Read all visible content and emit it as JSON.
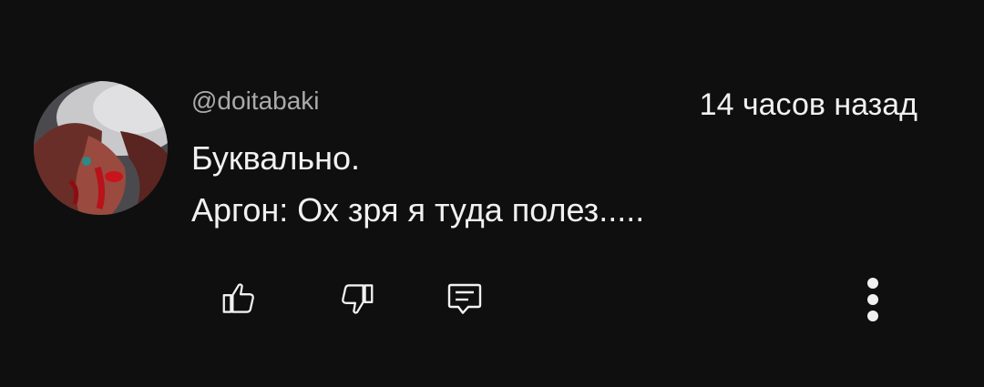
{
  "comment": {
    "author": "@doitabaki",
    "timestamp": "14 часов назад",
    "text_lines": [
      "Буквально.",
      "Аргон: Ох зря я туда полез....."
    ]
  },
  "actions": {
    "like_icon": "thumbs-up-icon",
    "dislike_icon": "thumbs-down-icon",
    "reply_icon": "reply-comment-icon",
    "more_icon": "vertical-dots-icon"
  },
  "colors": {
    "background": "#0f0f0f",
    "text_primary": "#f1f1f1",
    "text_secondary": "#aaaaaa"
  }
}
